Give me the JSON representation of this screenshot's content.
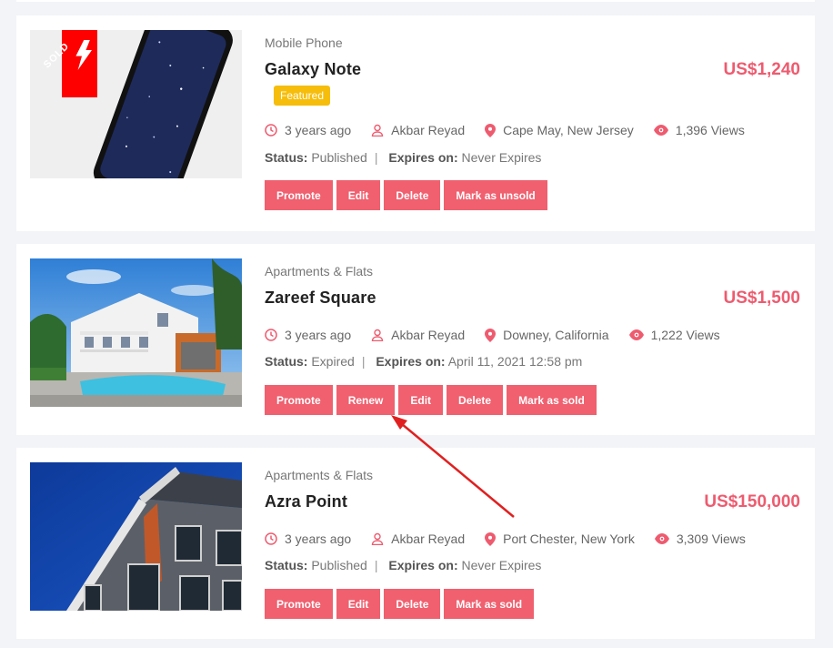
{
  "listings": [
    {
      "category": "Mobile Phone",
      "title": "Galaxy Note",
      "price": "US$1,240",
      "badge": "Featured",
      "sold_label": "SOLD",
      "time": "3 years ago",
      "author": "Akbar Reyad",
      "location": "Cape May, New Jersey",
      "views": "1,396 Views",
      "status_label": "Status:",
      "status_value": "Published",
      "expires_label": "Expires on:",
      "expires_value": "Never Expires",
      "buttons": [
        "Promote",
        "Edit",
        "Delete",
        "Mark as unsold"
      ]
    },
    {
      "category": "Apartments & Flats",
      "title": "Zareef Square",
      "price": "US$1,500",
      "time": "3 years ago",
      "author": "Akbar Reyad",
      "location": "Downey, California",
      "views": "1,222 Views",
      "status_label": "Status:",
      "status_value": "Expired",
      "expires_label": "Expires on:",
      "expires_value": "April 11, 2021 12:58 pm",
      "buttons": [
        "Promote",
        "Renew",
        "Edit",
        "Delete",
        "Mark as sold"
      ]
    },
    {
      "category": "Apartments & Flats",
      "title": "Azra Point",
      "price": "US$150,000",
      "time": "3 years ago",
      "author": "Akbar Reyad",
      "location": "Port Chester, New York",
      "views": "3,309 Views",
      "status_label": "Status:",
      "status_value": "Published",
      "expires_label": "Expires on:",
      "expires_value": "Never Expires",
      "buttons": [
        "Promote",
        "Edit",
        "Delete",
        "Mark as sold"
      ]
    }
  ],
  "icons": {
    "time": "clock-icon",
    "author": "user-icon",
    "location": "map-pin-icon",
    "views": "eye-icon",
    "sold": "bolt-icon"
  },
  "colors": {
    "accent": "#f0606f",
    "price": "#ee5b6f",
    "featured": "#f6bd0a",
    "sold_ribbon": "#ff0000",
    "annotation_arrow": "#e02020"
  }
}
